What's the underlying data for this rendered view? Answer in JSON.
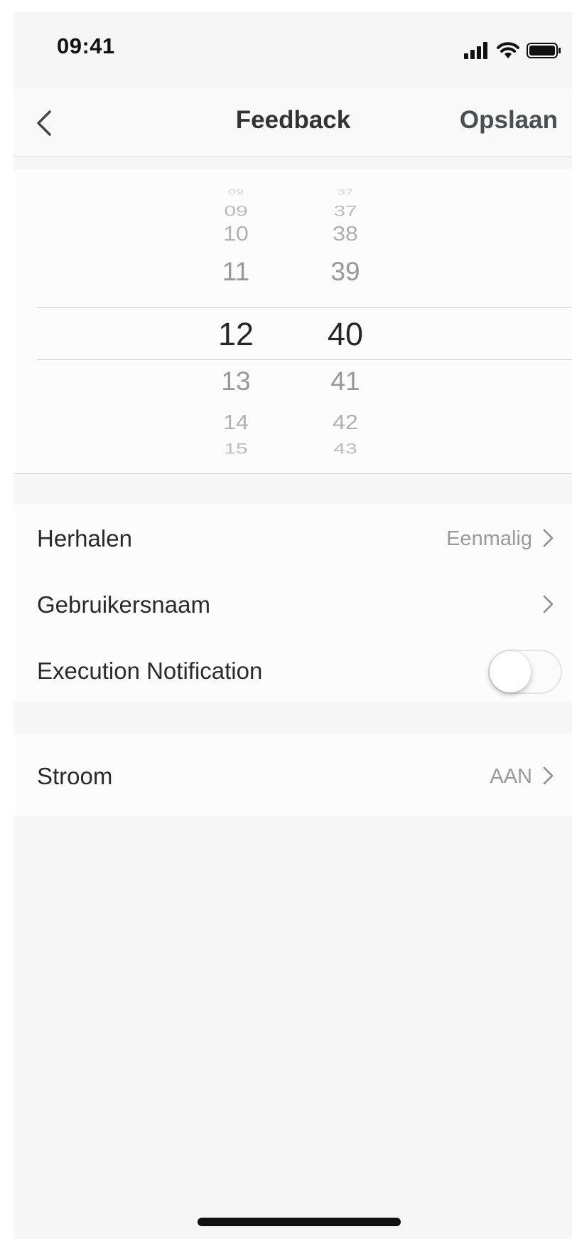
{
  "status_bar": {
    "time": "09:41"
  },
  "nav": {
    "title": "Feedback",
    "save_label": "Opslaan"
  },
  "picker": {
    "hours": {
      "far_above": "09",
      "above2": "10",
      "above1": "11",
      "selected": "12",
      "below1": "13",
      "below2": "14",
      "far_below": "15"
    },
    "minutes": {
      "far_above": "37",
      "above2": "38",
      "above1": "39",
      "selected": "40",
      "below1": "41",
      "below2": "42",
      "far_below": "43"
    }
  },
  "settings": {
    "repeat": {
      "label": "Herhalen",
      "value": "Eenmalig"
    },
    "username": {
      "label": "Gebruikersnaam"
    },
    "notification": {
      "label": "Execution Notification",
      "enabled": false
    }
  },
  "power": {
    "label": "Stroom",
    "value": "AAN"
  }
}
